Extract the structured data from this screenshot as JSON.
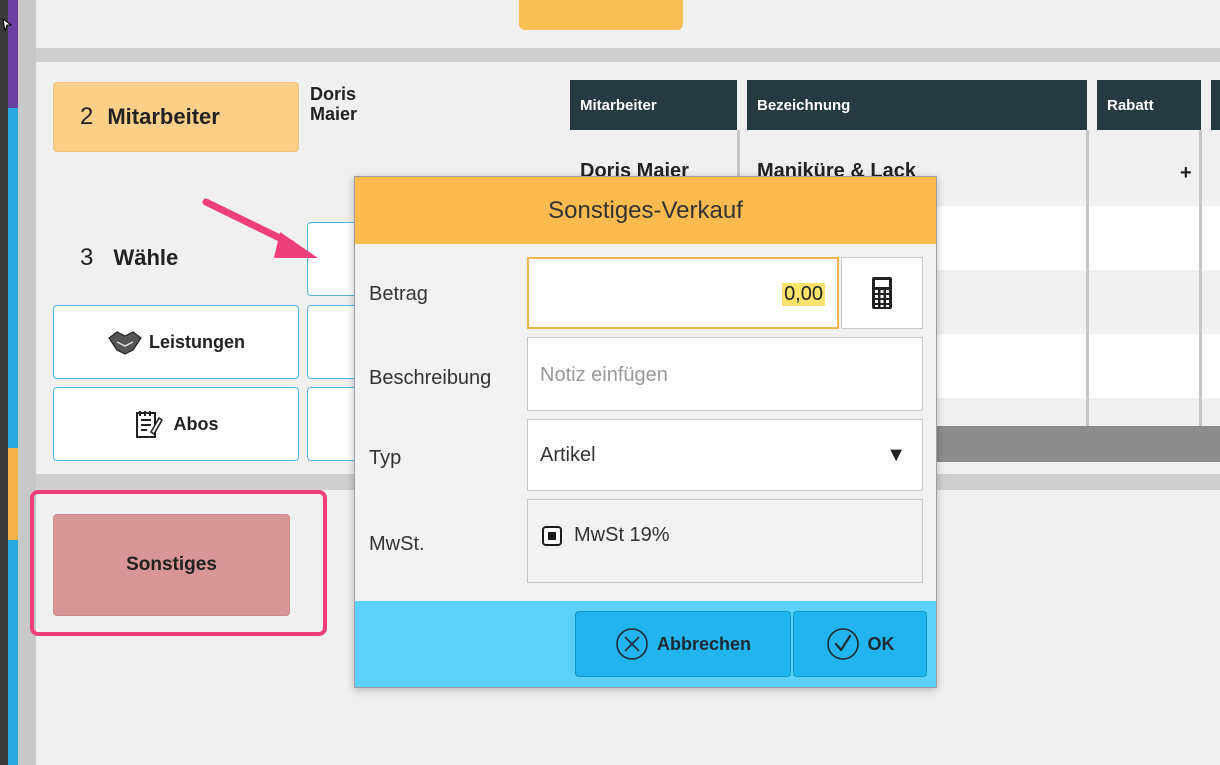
{
  "steps": {
    "mitarbeiter": {
      "number": "2",
      "label": "Mitarbeiter"
    },
    "waehle": {
      "number": "3",
      "label": "Wähle"
    }
  },
  "employee_name": "Doris Maier",
  "categories": [
    {
      "label": "Leistungen",
      "icon": "handshake-icon"
    },
    {
      "label": "Abos",
      "icon": "notepad-pen-icon"
    }
  ],
  "table": {
    "headers": [
      "Mitarbeiter",
      "Bezeichnung",
      "Rabatt"
    ],
    "rows": [
      {
        "mitarbeiter": "Doris Maier",
        "bezeichnung": "Maniküre & Lack",
        "rabatt": "+"
      }
    ]
  },
  "sonstiges_button": "Sonstiges",
  "dialog": {
    "title": "Sonstiges-Verkauf",
    "betrag_label": "Betrag",
    "betrag_value": "0,00",
    "beschreibung_label": "Beschreibung",
    "beschreibung_placeholder": "Notiz einfügen",
    "typ_label": "Typ",
    "typ_value": "Artikel",
    "mwst_label": "MwSt.",
    "mwst_option": "MwSt 19%",
    "cancel_label": "Abbrechen",
    "ok_label": "OK"
  },
  "colors": {
    "accent_orange": "#fbbb4f",
    "accent_blue": "#21b4ef",
    "highlight_pink": "#ef3f7a",
    "table_header": "#263a42"
  }
}
